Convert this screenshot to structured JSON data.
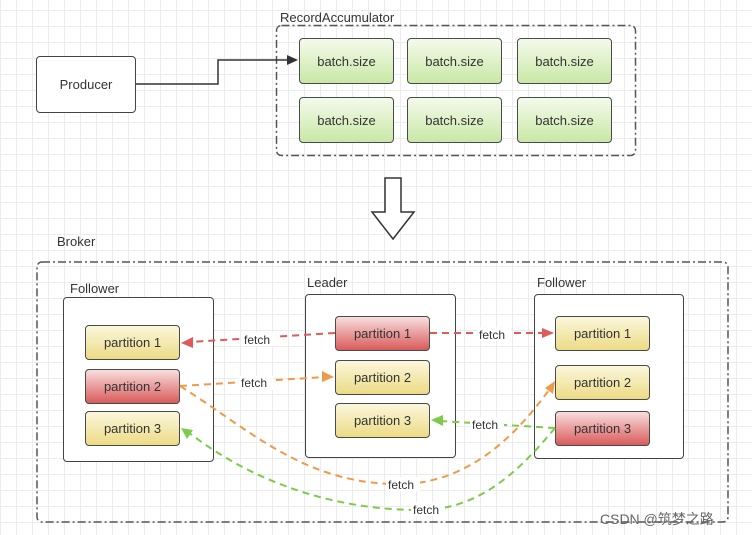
{
  "producer": {
    "label": "Producer"
  },
  "accumulator": {
    "title": "RecordAccumulator",
    "batches": [
      "batch.size",
      "batch.size",
      "batch.size",
      "batch.size",
      "batch.size",
      "batch.size"
    ]
  },
  "flow_arrow": {
    "icon": "down-arrow-icon"
  },
  "broker": {
    "title": "Broker",
    "nodes": [
      {
        "role": "Follower",
        "partitions": [
          {
            "label": "partition 1",
            "state": "replica"
          },
          {
            "label": "partition 2",
            "state": "leader"
          },
          {
            "label": "partition 3",
            "state": "replica"
          }
        ]
      },
      {
        "role": "Leader",
        "partitions": [
          {
            "label": "partition 1",
            "state": "leader"
          },
          {
            "label": "partition 2",
            "state": "replica"
          },
          {
            "label": "partition 3",
            "state": "replica"
          }
        ]
      },
      {
        "role": "Follower",
        "partitions": [
          {
            "label": "partition 1",
            "state": "replica"
          },
          {
            "label": "partition 2",
            "state": "replica"
          },
          {
            "label": "partition 3",
            "state": "leader"
          }
        ]
      }
    ],
    "fetch_edges": [
      {
        "label": "fetch",
        "from": "leader.partition 1",
        "to": "follower-left.partition 1",
        "color": "#e05a5a"
      },
      {
        "label": "fetch",
        "from": "leader.partition 1",
        "to": "follower-right.partition 1",
        "color": "#e05a5a"
      },
      {
        "label": "fetch",
        "from": "follower-left.partition 2",
        "to": "leader.partition 2",
        "color": "#ee9a4a"
      },
      {
        "label": "fetch",
        "from": "follower-left.partition 2",
        "to": "follower-right.partition 2",
        "color": "#ee9a4a"
      },
      {
        "label": "fetch",
        "from": "follower-right.partition 3",
        "to": "leader.partition 3",
        "color": "#7ccc4a"
      },
      {
        "label": "fetch",
        "from": "follower-right.partition 3",
        "to": "follower-left.partition 3",
        "color": "#7ccc4a"
      }
    ]
  },
  "colors": {
    "batch_fill": "#c9e8a6",
    "replica_fill": "#ecdb85",
    "leader_fill": "#da5b5b",
    "red_edge": "#e05a5a",
    "orange_edge": "#ee9a4a",
    "green_edge": "#7ccc4a"
  },
  "watermark": "CSDN @筑梦之路"
}
